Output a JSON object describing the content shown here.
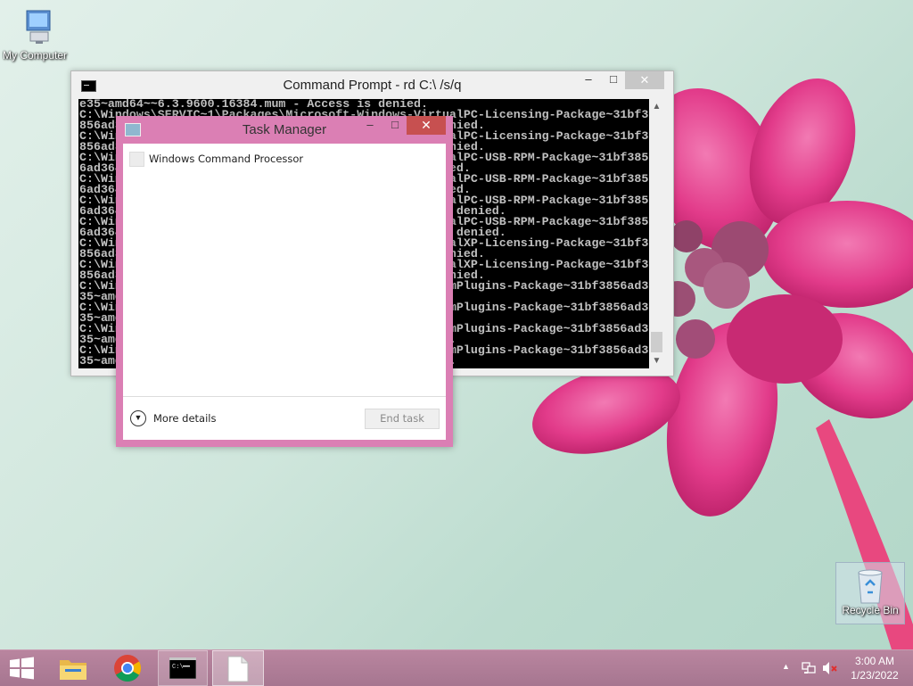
{
  "desktop": {
    "icons": {
      "my_computer": "My Computer",
      "recycle_bin": "Recycle Bin"
    }
  },
  "cmd_window": {
    "title": "Command Prompt - rd  C:\\ /s/q",
    "buttons": {
      "minimize": "–",
      "maximize": "□",
      "close": "✕"
    },
    "console_lines": [
      "e35~amd64~~6.3.9600.16384.mum - Access is denied.",
      "C:\\Windows\\SERVIC~1\\Packages\\Microsoft-Windows-VirtualPC-Licensing-Package~31bf3",
      "856ad364e35~amd64~~6.3.9600.16384.cat - Access is denied.",
      "C:\\Windows\\SERVIC~1\\Packages\\Microsoft-Windows-VirtualPC-Licensing-Package~31bf3",
      "856ad364e35~amd64~~6.3.9600.16384.mum - Access is denied.",
      "C:\\Windows\\SERVIC~1\\Packages\\Microsoft-Windows-VirtualPC-USB-RPM-Package~31bf385",
      "6ad364e35~amd64~~6.3.9600.16384.cat - Access is denied.",
      "C:\\Windows\\SERVIC~1\\Packages\\Microsoft-Windows-VirtualPC-USB-RPM-Package~31bf385",
      "6ad364e35~amd64~~6.3.9600.16384.mum - Access is denied.",
      "C:\\Windows\\SERVIC~1\\Packages\\Microsoft-Windows-VirtualPC-USB-RPM-Package~31bf385",
      "6ad364e35~amd64~en-US~6.3.9600.16384.cat - Access is denied.",
      "C:\\Windows\\SERVIC~1\\Packages\\Microsoft-Windows-VirtualPC-USB-RPM-Package~31bf385",
      "6ad364e35~amd64~en-US~6.3.9600.16384.mum - Access is denied.",
      "C:\\Windows\\SERVIC~1\\Packages\\Microsoft-Windows-VirtualXP-Licensing-Package~31bf3",
      "856ad364e35~amd64~~6.3.9600.16384.cat - Access is denied.",
      "C:\\Windows\\SERVIC~1\\Packages\\Microsoft-Windows-VirtualXP-Licensing-Package~31bf3",
      "856ad364e35~amd64~~6.3.9600.16384.mum - Access is denied.",
      "C:\\Windows\\SERVIC~1\\Packages\\Microsoft-Windows-WebcamPlugins-Package~31bf3856ad364e",
      "35~amd64~~6.3.9600.16384.cat - Access is denied.",
      "C:\\Windows\\SERVIC~1\\Packages\\Microsoft-Windows-WebcamPlugins-Package~31bf3856ad364e",
      "35~amd64~~6.3.9600.16384.mum - Access is denied.",
      "C:\\Windows\\SERVIC~1\\Packages\\Microsoft-Windows-WebcamPlugins-Package~31bf3856ad364e",
      "35~amd64~en-US~6.3.9600.16384.cat - Access is denied.",
      "C:\\Windows\\SERVIC~1\\Packages\\Microsoft-Windows-WebcamPlugins-Package~31bf3856ad364e",
      "35~amd64~en-US~6.3.9600.16384.mum - Access is denied."
    ]
  },
  "task_manager": {
    "title": "Task Manager",
    "buttons": {
      "minimize": "–",
      "maximize": "□",
      "close": "✕"
    },
    "apps": [
      "Windows Command Processor"
    ],
    "more_details": "More details",
    "end_task": "End task"
  },
  "taskbar": {
    "time": "3:00 AM",
    "date": "1/23/2022"
  },
  "colors": {
    "taskmanager_frame": "#db7fb4",
    "taskbar": "#a67690",
    "close_red": "#c75050"
  },
  "icons": [
    "windows-logo-icon",
    "file-explorer-icon",
    "chrome-icon",
    "cmd-icon",
    "document-icon",
    "network-icon",
    "volume-muted-icon"
  ]
}
